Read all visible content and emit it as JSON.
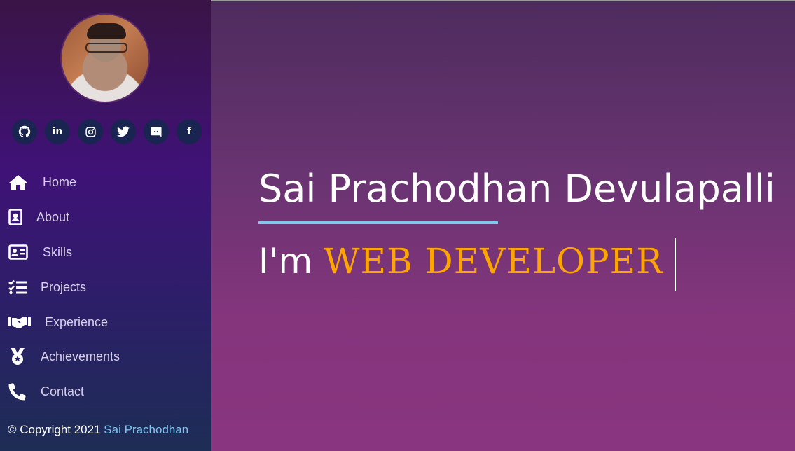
{
  "sidebar": {
    "socials": [
      {
        "icon": "github-icon",
        "glyph": "◉"
      },
      {
        "icon": "linkedin-icon",
        "glyph": "in"
      },
      {
        "icon": "instagram-icon",
        "glyph": "◎"
      },
      {
        "icon": "twitter-icon",
        "glyph": "🐦"
      },
      {
        "icon": "discord-icon",
        "glyph": "◓"
      },
      {
        "icon": "facebook-icon",
        "glyph": "f"
      }
    ],
    "nav": [
      {
        "label": "Home",
        "icon": "home-icon"
      },
      {
        "label": "About",
        "icon": "about-icon"
      },
      {
        "label": "Skills",
        "icon": "skills-icon"
      },
      {
        "label": "Projects",
        "icon": "projects-icon"
      },
      {
        "label": "Experience",
        "icon": "experience-icon"
      },
      {
        "label": "Achievements",
        "icon": "achievements-icon"
      },
      {
        "label": "Contact",
        "icon": "contact-icon"
      }
    ],
    "footer": {
      "copyright": "© Copyright 2021",
      "author": "Sai Prachodhan"
    }
  },
  "main": {
    "name": "Sai Prachodhan Devulapalli",
    "role_prefix": "I'm",
    "role": "WEB DEVELOPER"
  },
  "colors": {
    "accent": "#ffa500",
    "underline": "#7ec8ee",
    "link": "#7cc4ef"
  }
}
